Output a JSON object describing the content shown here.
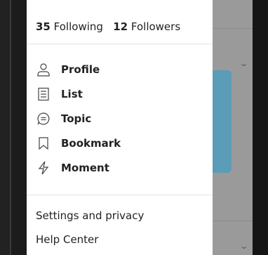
{
  "stats": {
    "following_count": "35",
    "following_label": "Following",
    "followers_count": "12",
    "followers_label": "Followers"
  },
  "menu": [
    {
      "label": "Profile",
      "icon": "person-icon"
    },
    {
      "label": "List",
      "icon": "list-icon"
    },
    {
      "label": "Topic",
      "icon": "topic-icon"
    },
    {
      "label": "Bookmark",
      "icon": "bookmark-icon"
    },
    {
      "label": "Moment",
      "icon": "lightning-icon"
    }
  ],
  "footer": {
    "settings_label": "Settings and privacy",
    "help_label": "Help Center"
  },
  "colors": {
    "card_accent": "#5b9cb8",
    "backdrop": "#9a9a9a"
  }
}
